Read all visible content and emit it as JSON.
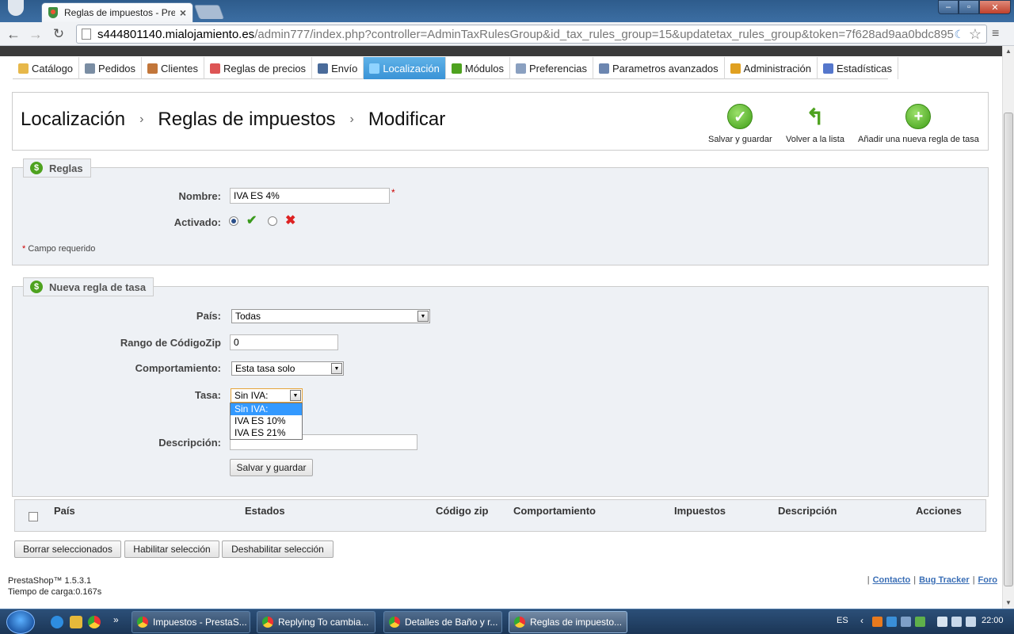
{
  "browser": {
    "tab_title": "Reglas de impuestos - Pre",
    "url_host": "s444801140.mialojamiento.es",
    "url_path": "/admin777/index.php?controller=AdminTaxRulesGroup&id_tax_rules_group=15&updatetax_rules_group&token=7f628ad9aa0bdc895"
  },
  "menu": [
    {
      "label": "Catálogo",
      "color": "#e7b84a"
    },
    {
      "label": "Pedidos",
      "color": "#7a8da3"
    },
    {
      "label": "Clientes",
      "color": "#c2763a"
    },
    {
      "label": "Reglas de precios",
      "color": "#d55"
    },
    {
      "label": "Envío",
      "color": "#4a6b9a"
    },
    {
      "label": "Localización",
      "color": "#8fd3ff"
    },
    {
      "label": "Módulos",
      "color": "#4ea21f"
    },
    {
      "label": "Preferencias",
      "color": "#8aa0c0"
    },
    {
      "label": "Parametros avanzados",
      "color": "#6c86b0"
    },
    {
      "label": "Administración",
      "color": "#e0a020"
    },
    {
      "label": "Estadísticas",
      "color": "#5577cc"
    }
  ],
  "header": {
    "crumb1": "Localización",
    "crumb2": "Reglas de impuestos",
    "crumb3": "Modificar",
    "sep": "›",
    "save_label": "Salvar y guardar",
    "back_label": "Volver a la lista",
    "add_label": "Añadir una nueva regla de tasa"
  },
  "rules": {
    "legend": "Reglas",
    "nombre_label": "Nombre:",
    "nombre_value": "IVA ES 4%",
    "activado_label": "Activado:",
    "required_note": "Campo requerido"
  },
  "new_rule": {
    "legend": "Nueva regla de tasa",
    "pais_label": "País:",
    "pais_value": "Todas",
    "zip_label": "Rango de CódigoZip",
    "zip_value": "0",
    "comport_label": "Comportamiento:",
    "comport_value": "Esta tasa solo",
    "tasa_label": "Tasa:",
    "tasa_value": "Sin IVA:",
    "tasa_options": [
      "Sin IVA:",
      "IVA ES 10%",
      "IVA ES 21%"
    ],
    "desc_label": "Descripción:",
    "desc_value": "",
    "submit_label": "Salvar y guardar"
  },
  "table": {
    "headers": [
      "País",
      "Estados",
      "Código zip",
      "Comportamiento",
      "Impuestos",
      "Descripción",
      "Acciones"
    ]
  },
  "bulk": {
    "delete_label": "Borrar seleccionados",
    "enable_label": "Habilitar selección",
    "disable_label": "Deshabilitar selección"
  },
  "footer": {
    "version": "PrestaShop™ 1.5.3.1",
    "load_time": "Tiempo de carga:0.167s",
    "contact": "Contacto",
    "bug": "Bug Tracker",
    "forum": "Foro",
    "sep": "|"
  },
  "taskbar": {
    "tasks": [
      "Impuestos - PrestaS...",
      "Replying To cambia...",
      "Detalles de Baño y r...",
      "Reglas de impuesto..."
    ],
    "lang": "ES",
    "clock": "22:00"
  }
}
